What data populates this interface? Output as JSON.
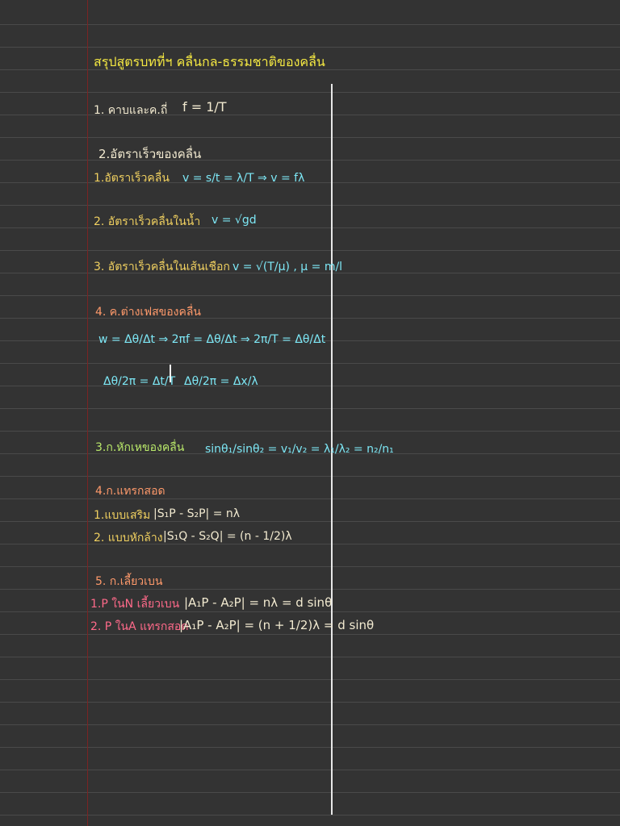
{
  "title": "สรุปสูตรบทที่ฯ คลื่นกล-ธรรมชาติของคลื่น",
  "s1": {
    "label": "1. คาบและค.ถี่",
    "formula": "f = 1/T"
  },
  "s2": {
    "heading": "2.อัตราเร็วของคลื่น",
    "line1": {
      "label": "1.อัตราเร็วคลื่น",
      "formula": "v = s/t = λ/T ⇒ v = fλ"
    },
    "line2": {
      "label": "2. อัตราเร็วคลื่นในน้ำ",
      "formula": "v = √gd"
    },
    "line3": {
      "label": "3. อัตราเร็วคลื่นในเส้นเชือก",
      "formula": "v = √(T/μ) , μ = m/l"
    }
  },
  "s4a": {
    "heading": "4. ค.ต่างเฟสของคลื่น",
    "line1": "w = Δθ/Δt ⇒ 2πf = Δθ/Δt ⇒ 2π/T = Δθ/Δt",
    "line2_left": "Δθ/2π = Δt/T",
    "line2_right": "Δθ/2π = Δx/λ"
  },
  "s3": {
    "label": "3.ก.หักเหของคลื่น",
    "formula": "sinθ₁/sinθ₂ = v₁/v₂ = λ₁/λ₂ = n₂/n₁"
  },
  "s4b": {
    "heading": "4.ก.แทรกสอด",
    "line1": {
      "label": "1.แบบเสริม",
      "formula": "|S₁P - S₂P| = nλ"
    },
    "line2": {
      "label": "2. แบบหักล้าง",
      "formula": "|S₁Q - S₂Q| = (n - 1/2)λ"
    }
  },
  "s5": {
    "heading": "5. ก.เลี้ยวเบน",
    "line1": {
      "label": "1.P ในN เลี้ยวเบน",
      "formula": "|A₁P - A₂P| = nλ = d sinθ"
    },
    "line2": {
      "label": "2. P ในA แทรกสอด",
      "formula": "|A₁P - A₂P| = (n + 1/2)λ = d sinθ"
    }
  }
}
